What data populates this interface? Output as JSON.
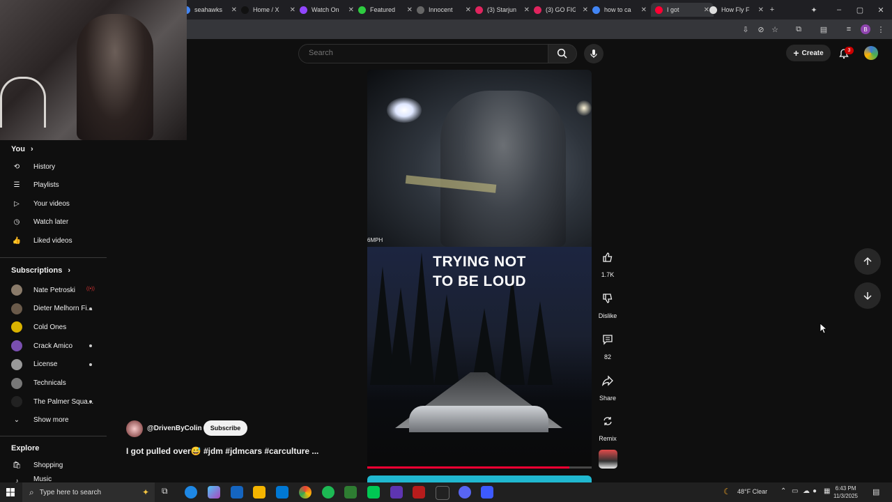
{
  "browser": {
    "tabs": [
      {
        "title": "seahawks",
        "favicon_color": "#4285f4"
      },
      {
        "title": "Home / X",
        "favicon_color": "#111111"
      },
      {
        "title": "Watch On",
        "favicon_color": "#9146ff"
      },
      {
        "title": "Featured",
        "favicon_color": "#2ecc40"
      },
      {
        "title": "Innocent",
        "favicon_color": "#666666"
      },
      {
        "title": "(3) Starjun",
        "favicon_color": "#e0245e"
      },
      {
        "title": "(3) GO FIG",
        "favicon_color": "#e0245e"
      },
      {
        "title": "how to ca",
        "favicon_color": "#4285f4"
      },
      {
        "title": "I got",
        "favicon_color": "#ff0033",
        "active": true
      },
      {
        "title": "How Fly F",
        "favicon_color": "#dddddd"
      }
    ],
    "new_tab": "+",
    "profile_initial": "B"
  },
  "header": {
    "search_placeholder": "Search",
    "create_label": "Create",
    "notification_count": "3"
  },
  "sidebar": {
    "you_label": "You",
    "you_items": [
      {
        "label": "History",
        "icon": "history-icon"
      },
      {
        "label": "Playlists",
        "icon": "playlists-icon"
      },
      {
        "label": "Your videos",
        "icon": "your-videos-icon"
      },
      {
        "label": "Watch later",
        "icon": "clock-icon"
      },
      {
        "label": "Liked videos",
        "icon": "thumb-up-icon"
      }
    ],
    "subscriptions_label": "Subscriptions",
    "subscriptions": [
      {
        "label": "Nate Petroski",
        "color": "#8a7b6a",
        "live": true
      },
      {
        "label": "Dieter Melhorn Fi...",
        "color": "#6a5a4a",
        "dot": true
      },
      {
        "label": "Cold Ones",
        "color": "#d9b200"
      },
      {
        "label": "Crack Amico",
        "color": "#7a4fb0",
        "dot": true
      },
      {
        "label": "License",
        "color": "#999999",
        "dot": true
      },
      {
        "label": "Technicals",
        "color": "#777777"
      },
      {
        "label": "The Palmer Squa...",
        "color": "#222222",
        "dot": true
      }
    ],
    "show_more_label": "Show more",
    "explore_label": "Explore",
    "explore_items": [
      {
        "label": "Shopping",
        "icon": "shopping-bag-icon"
      },
      {
        "label": "Music",
        "icon": "music-icon"
      }
    ]
  },
  "video": {
    "speed_overlay": "6MPH",
    "caption_line1": "TRYING NOT",
    "caption_line2": "TO BE LOUD",
    "progress": 0.9,
    "channel_handle": "@DrivenByColin",
    "subscribe_label": "Subscribe",
    "title": "I got pulled over😅 #jdm #jdmcars #carculture ..."
  },
  "actions": {
    "like_count": "1.7K",
    "dislike_label": "Dislike",
    "comment_count": "82",
    "share_label": "Share",
    "remix_label": "Remix"
  },
  "taskbar": {
    "search_text": "Type here to search",
    "weather": "48°F  Clear",
    "time": "6:43 PM",
    "date": "11/3/2025"
  }
}
